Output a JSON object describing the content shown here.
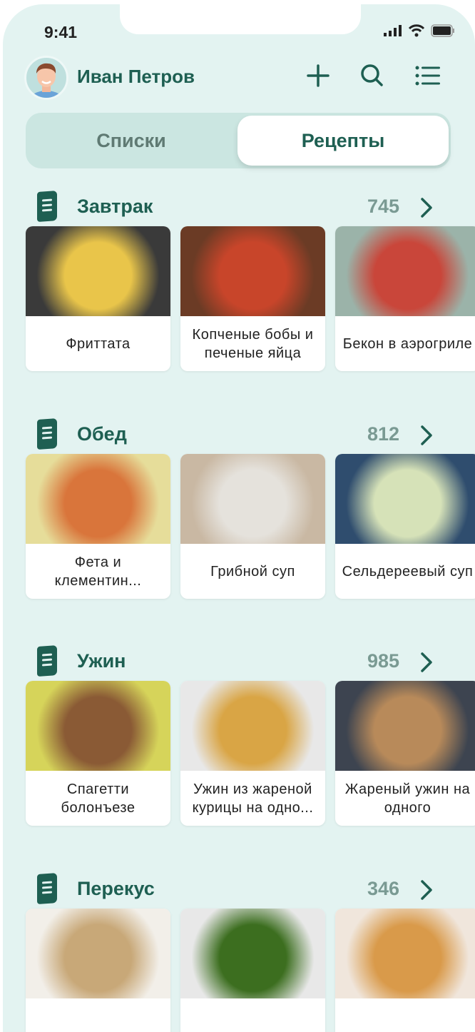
{
  "status": {
    "time": "9:41"
  },
  "header": {
    "user_name": "Иван Петров"
  },
  "tabs": [
    {
      "label": "Списки",
      "active": false
    },
    {
      "label": "Рецепты",
      "active": true
    }
  ],
  "sections": [
    {
      "title": "Завтрак",
      "count": "745",
      "recipes": [
        {
          "name": "Фриттата",
          "colors": [
            "#3a3a3a",
            "#e9c54a"
          ]
        },
        {
          "name": "Копченые бобы и печеные яйца",
          "colors": [
            "#6b3b25",
            "#c8452a"
          ]
        },
        {
          "name": "Бекон в аэрогриле",
          "colors": [
            "#9bb3a9",
            "#c9463a"
          ]
        }
      ]
    },
    {
      "title": "Обед",
      "count": "812",
      "recipes": [
        {
          "name": "Фета и клементин...",
          "colors": [
            "#e6dd9a",
            "#d9753b"
          ]
        },
        {
          "name": "Грибной суп",
          "colors": [
            "#c9b8a3",
            "#e5e2dc"
          ]
        },
        {
          "name": "Сельдереевый суп",
          "colors": [
            "#2f4d6e",
            "#d6e2b8"
          ]
        }
      ]
    },
    {
      "title": "Ужин",
      "count": "985",
      "recipes": [
        {
          "name": "Спагетти болонъезе",
          "colors": [
            "#d6d45a",
            "#8a5a35"
          ]
        },
        {
          "name": "Ужин из жареной курицы на одно...",
          "colors": [
            "#e8e8e8",
            "#d9a545"
          ]
        },
        {
          "name": "Жареный ужин на одного",
          "colors": [
            "#3d4450",
            "#b88a5a"
          ]
        }
      ]
    },
    {
      "title": "Перекус",
      "count": "346",
      "recipes": [
        {
          "name": "",
          "colors": [
            "#f2efe9",
            "#c8a878"
          ]
        },
        {
          "name": "",
          "colors": [
            "#e8e8e8",
            "#3c6e1f"
          ]
        },
        {
          "name": "",
          "colors": [
            "#f0e6dc",
            "#d99a4a"
          ]
        }
      ]
    }
  ],
  "colors": {
    "bg": "#e3f3f1",
    "accent": "#1e5f52",
    "muted": "#7a9a93"
  }
}
